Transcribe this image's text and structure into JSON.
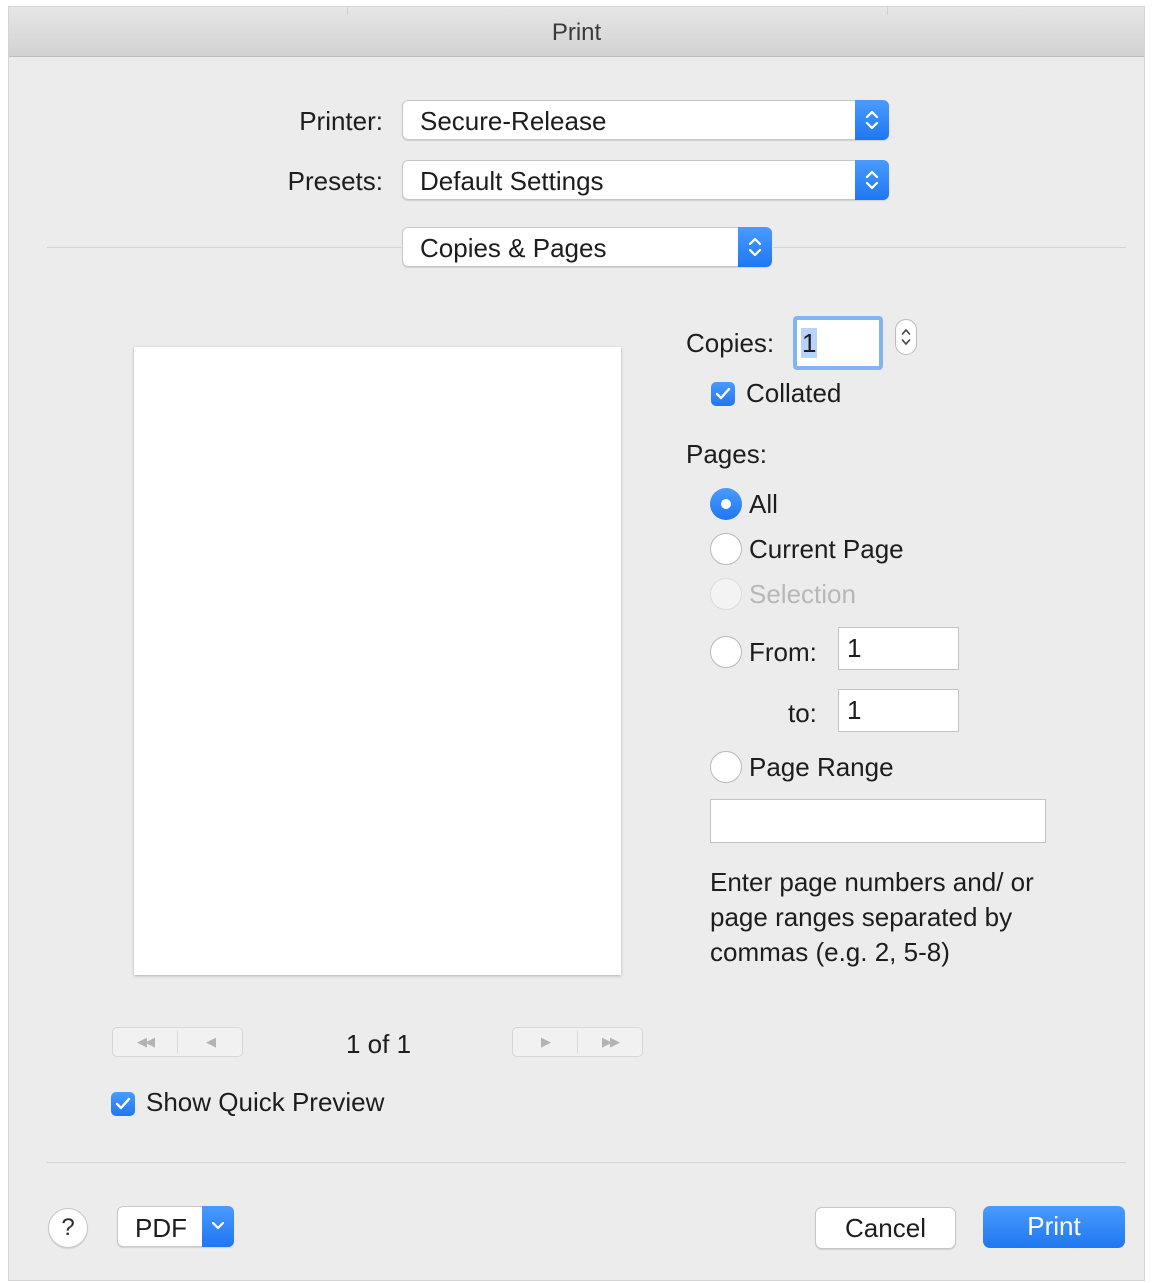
{
  "window": {
    "title": "Print"
  },
  "printer": {
    "label": "Printer:",
    "value": "Secure-Release"
  },
  "presets": {
    "label": "Presets:",
    "value": "Default Settings"
  },
  "section_popup": {
    "value": "Copies & Pages"
  },
  "preview": {
    "page_indicator": "1 of 1",
    "show_quick_preview": {
      "label": "Show Quick Preview",
      "checked": true
    }
  },
  "copies": {
    "label": "Copies:",
    "value": "1",
    "collated": {
      "label": "Collated",
      "checked": true
    }
  },
  "pages": {
    "label": "Pages:",
    "options": {
      "all": {
        "label": "All",
        "selected": true
      },
      "current": {
        "label": "Current Page",
        "selected": false
      },
      "selection": {
        "label": "Selection",
        "enabled": false
      },
      "from": {
        "label": "From:",
        "value": "1"
      },
      "to": {
        "label": "to:",
        "value": "1"
      },
      "range": {
        "label": "Page Range",
        "value": ""
      }
    },
    "hint": "Enter page numbers and/ or page ranges separated by commas (e.g. 2, 5-8)"
  },
  "footer": {
    "help": "?",
    "pdf": "PDF",
    "cancel": "Cancel",
    "print": "Print"
  },
  "colors": {
    "accent": "#2a84f6",
    "window_bg": "#ececec"
  }
}
